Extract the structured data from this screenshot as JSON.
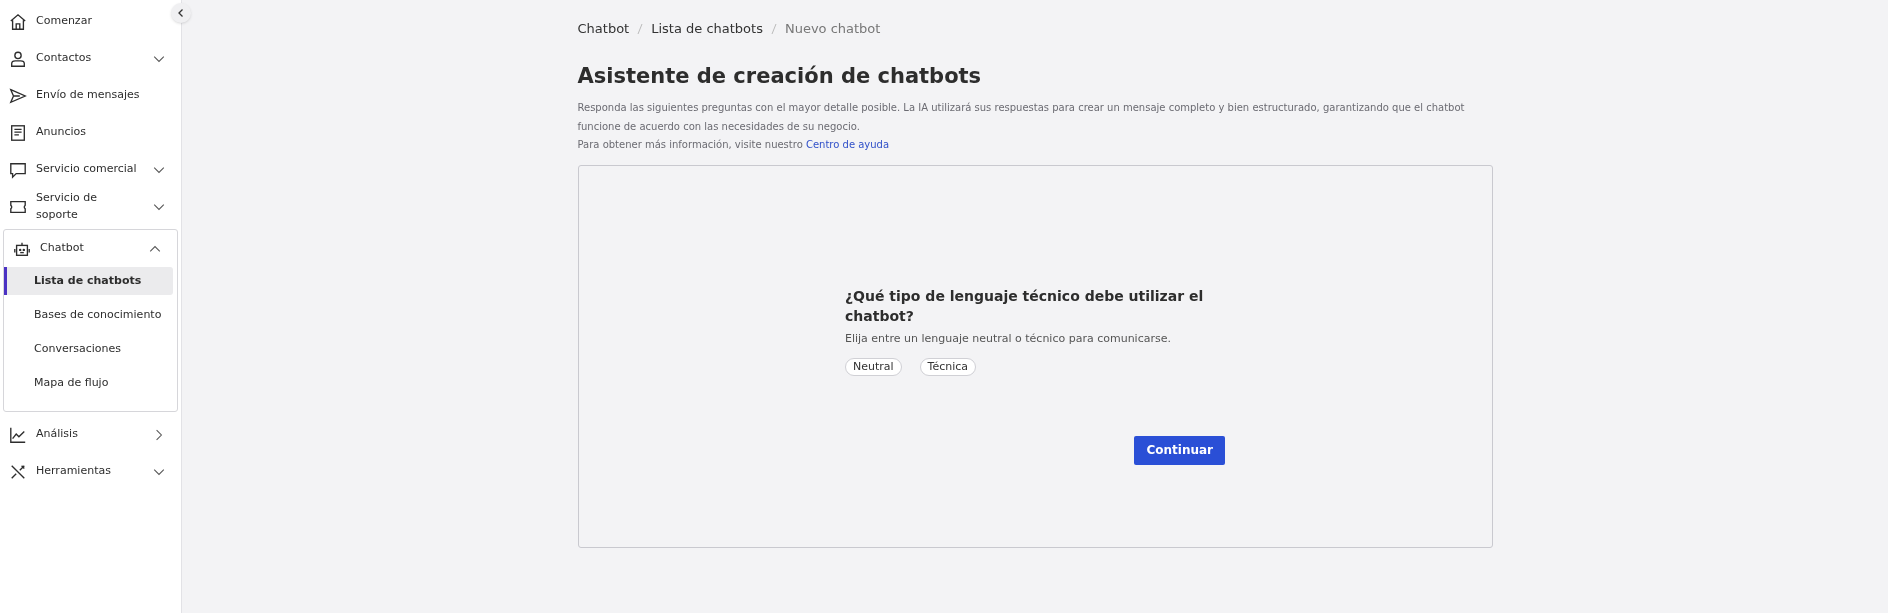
{
  "sidebar": {
    "items": [
      {
        "kind": "link",
        "label": "Comenzar"
      },
      {
        "kind": "group",
        "label": "Contactos",
        "expanded": false
      },
      {
        "kind": "link",
        "label": "Envío de mensajes"
      },
      {
        "kind": "link",
        "label": "Anuncios"
      },
      {
        "kind": "group",
        "label": "Servicio comercial",
        "expanded": false
      },
      {
        "kind": "group",
        "label": "Servicio de soporte",
        "expanded": false
      },
      {
        "kind": "group",
        "label": "Chatbot",
        "expanded": true,
        "children": [
          {
            "label": "Lista de chatbots",
            "selected": true
          },
          {
            "label": "Bases de conocimiento",
            "selected": false
          },
          {
            "label": "Conversaciones",
            "selected": false
          },
          {
            "label": "Mapa de flujo",
            "selected": false
          }
        ]
      },
      {
        "kind": "nav",
        "label": "Análisis"
      },
      {
        "kind": "group",
        "label": "Herramientas",
        "expanded": false
      }
    ]
  },
  "breadcrumb": [
    "Chatbot",
    "Lista de chatbots",
    "Nuevo chatbot"
  ],
  "title": "Asistente de creación de chatbots",
  "description": "Responda las siguientes preguntas con el mayor detalle posible. La IA utilizará sus respuestas para crear un mensaje completo y bien estructurado, garantizando que el chatbot funcione de acuerdo con las necesidades de su negocio.",
  "help": {
    "text": "Para obtener más información, visite nuestro",
    "link": "Centro de ayuda"
  },
  "question": {
    "title": "¿Qué tipo de lenguaje técnico debe utilizar el chatbot?",
    "hint": "Elija entre un lenguaje neutral o técnico para comunicarse.",
    "options": [
      {
        "label": "Neutral",
        "selected": false
      },
      {
        "label": "Técnica",
        "selected": false
      }
    ]
  },
  "continue_button": "Continuar"
}
